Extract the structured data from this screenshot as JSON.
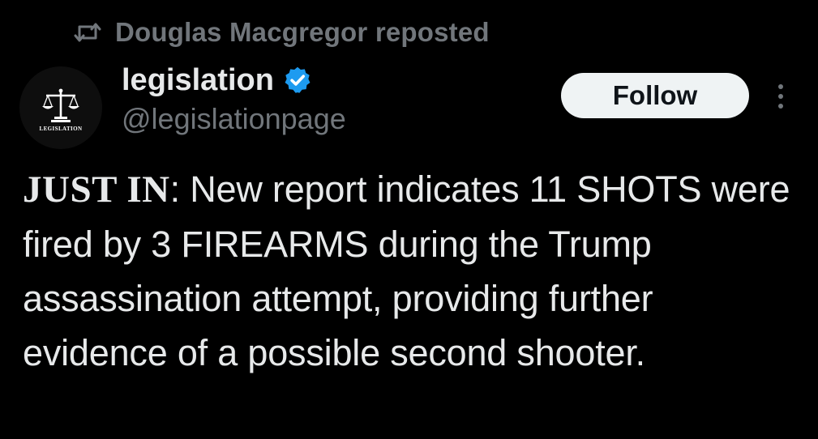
{
  "repost": {
    "icon": "repost-icon",
    "text": "Douglas Macgregor reposted"
  },
  "author": {
    "avatar_caption": "LEGISLATION",
    "avatar_icon": "scales-of-justice-icon",
    "name": "legislation",
    "verified_icon": "verified-badge-icon",
    "handle": "@legislationpage"
  },
  "actions": {
    "follow_label": "Follow",
    "more_icon": "more-vertical-icon"
  },
  "post": {
    "lead": "JUST IN",
    "colon": ":",
    "text": " New report indicates 11 SHOTS were fired by 3 FIREARMS during the Trump assassination attempt, providing further evidence of a possible second shooter."
  },
  "colors": {
    "background": "#000000",
    "text_primary": "#e7e9ea",
    "text_secondary": "#71767b",
    "verified_blue": "#1d9bf0",
    "follow_bg": "#eff3f4"
  }
}
